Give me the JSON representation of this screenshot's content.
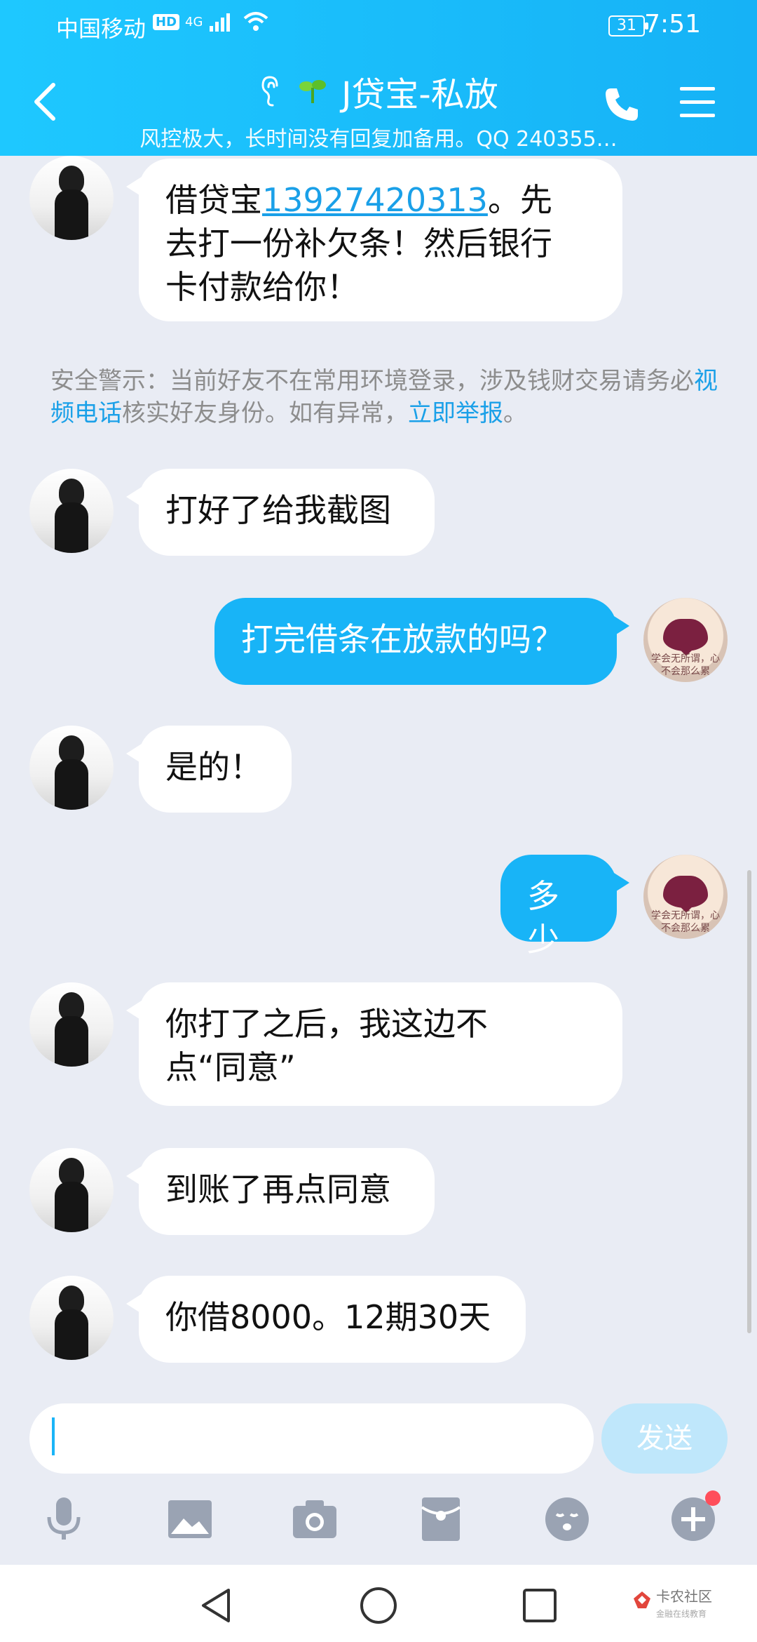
{
  "status": {
    "carrier": "中国移动",
    "hd": "HD",
    "network": "4G",
    "battery": "31",
    "time": "7:51"
  },
  "header": {
    "title": "J贷宝-私放",
    "subtitle": "风控极大，长时间没有回复加备用。QQ 240355…"
  },
  "messages": [
    {
      "side": "left",
      "text_prefix": "借贷宝",
      "link": "13927420313",
      "text_suffix_line1": "。先",
      "text_line2": "去打一份补欠条！然后银行",
      "text_line3": "卡付款给你！"
    },
    {
      "side": "left",
      "text": "打好了给我截图"
    },
    {
      "side": "right",
      "text": "打完借条在放款的吗？"
    },
    {
      "side": "left",
      "text": "是的！"
    },
    {
      "side": "right",
      "text": "多少"
    },
    {
      "side": "left",
      "text_line1": "你打了之后，我这边不",
      "text_line2": "点“同意”"
    },
    {
      "side": "left",
      "text": "到账了再点同意"
    },
    {
      "side": "left",
      "text": "你借8000。12期30天"
    }
  ],
  "warning": {
    "prefix": "安全警示：当前好友不在常用环境登录，涉及钱财交易请务必",
    "link1": "视频电话",
    "middle": "核实好友身份。如有异常，",
    "link2": "立即举报",
    "suffix": "。"
  },
  "avatar_right_text": "学会无所谓，心不会那么累",
  "input": {
    "send_label": "发送",
    "value": ""
  },
  "watermark": {
    "title": "卡农社区",
    "subtitle": "金融在线教育"
  },
  "colors": {
    "header": "#16b2f6",
    "bubble_right": "#18b4f7",
    "link": "#1aa0e8",
    "background": "#e9ecf4"
  },
  "icons": [
    "back-icon",
    "ear-icon",
    "sprout-icon",
    "phone-icon",
    "menu-icon",
    "mic-icon",
    "image-icon",
    "camera-icon",
    "red-packet-icon",
    "emoji-icon",
    "plus-icon",
    "nav-back-icon",
    "nav-home-icon",
    "nav-recent-icon"
  ]
}
